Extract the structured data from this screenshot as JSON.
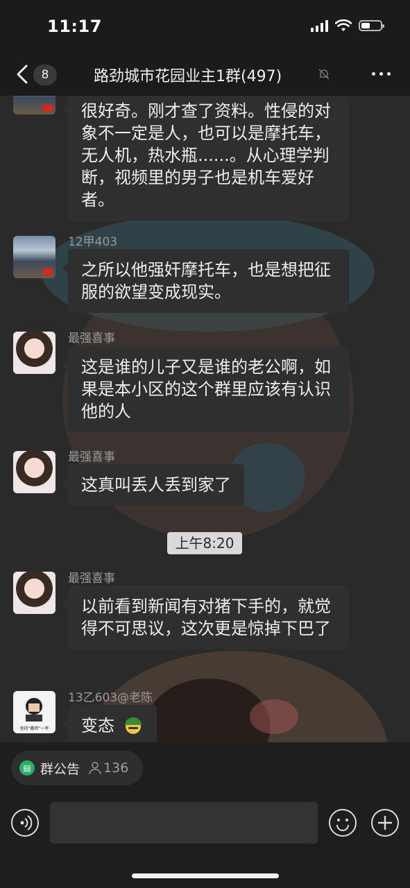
{
  "status_bar": {
    "time": "11:17"
  },
  "nav": {
    "back_icon": "chevron-left-icon",
    "unread_count": "8",
    "title": "路劲城市花园业主1群(497)",
    "mute_icon": "bell-off-icon",
    "more_icon": "more-dots-icon"
  },
  "messages": [
    {
      "sender": "",
      "text": "很好奇。刚才查了资料。性侵的对象不一定是人，也可以是摩托车，无人机，热水瓶......。从心理学判断，视频里的男子也是机车爱好者。"
    },
    {
      "sender": "12甲403",
      "text": "之所以他强奸摩托车，也是想把征服的欲望变成现实。"
    },
    {
      "sender": "最强喜事",
      "text": "这是谁的儿子又是谁的老公啊，如果是本小区的这个群里应该有认识他的人"
    },
    {
      "sender": "最强喜事",
      "text": "这真叫丢人丢到家了"
    },
    {
      "sender": "最强喜事",
      "text": "以前看到新闻有对猪下手的，就觉得不可思议，这次更是惊掉下巴了"
    },
    {
      "sender": "13乙603@老陈",
      "text": "变态"
    }
  ],
  "time_divider": "上午8:20",
  "bottom": {
    "announcement_label": "群公告",
    "member_count": "136",
    "avatar_meme_caption": "坚持“搬砖”一年"
  },
  "colors": {
    "accent_green": "#2aae67",
    "bubble": "#2f2f2f",
    "background": "#1b1b1b"
  }
}
